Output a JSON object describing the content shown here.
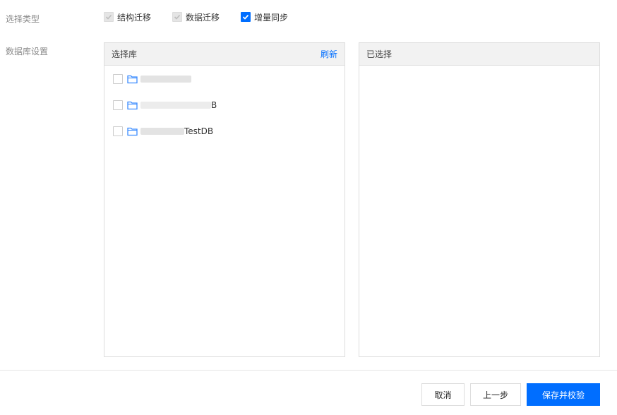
{
  "form": {
    "type_label": "选择类型",
    "db_label": "数据库设置"
  },
  "types": [
    {
      "label": "结构迁移",
      "state": "checked-disabled"
    },
    {
      "label": "数据迁移",
      "state": "checked-disabled"
    },
    {
      "label": "增量同步",
      "state": "checked"
    }
  ],
  "left_panel": {
    "title": "选择库",
    "refresh_label": "刷新",
    "items": [
      {
        "suffix": "",
        "checked": false
      },
      {
        "suffix": "B",
        "checked": false
      },
      {
        "suffix": "TestDB",
        "checked": false
      }
    ]
  },
  "right_panel": {
    "title": "已选择"
  },
  "footer": {
    "cancel_label": "取消",
    "prev_label": "上一步",
    "save_label": "保存并校验"
  },
  "colors": {
    "accent": "#006eff",
    "panel_header": "#f2f2f2",
    "border": "#dddddd"
  }
}
